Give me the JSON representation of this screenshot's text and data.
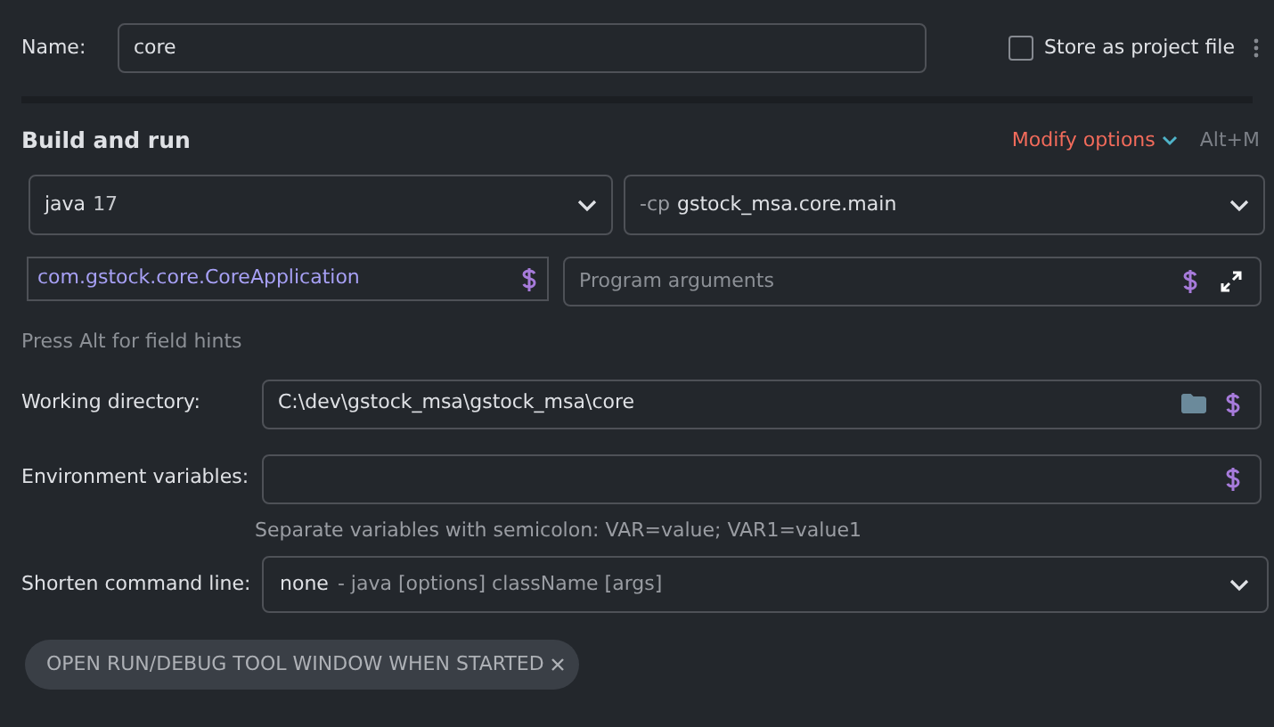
{
  "name_field": {
    "label": "Name:",
    "value": "core"
  },
  "store_as_project_file": {
    "label": "Store as project file",
    "checked": false
  },
  "section": {
    "title": "Build and run",
    "modify_options": "Modify options",
    "shortcut": "Alt+M"
  },
  "jre_select": {
    "prefix": "java",
    "value": "17"
  },
  "classpath_select": {
    "prefix": "-cp",
    "value": "gstock_msa.core.main"
  },
  "main_class": {
    "value": "com.gstock.core.CoreApplication"
  },
  "program_arguments": {
    "placeholder": "Program arguments"
  },
  "field_hint": "Press Alt for field hints",
  "working_directory": {
    "label": "Working directory:",
    "value": "C:\\dev\\gstock_msa\\gstock_msa\\core"
  },
  "environment_variables": {
    "label": "Environment variables:",
    "hint": "Separate variables with semicolon: VAR=value; VAR1=value1"
  },
  "shorten_command_line": {
    "label": "Shorten command line:",
    "value": "none",
    "description": "- java [options] className [args]"
  },
  "option_tags": [
    {
      "label": "OPEN RUN/DEBUG TOOL WINDOW WHEN STARTED"
    }
  ]
}
